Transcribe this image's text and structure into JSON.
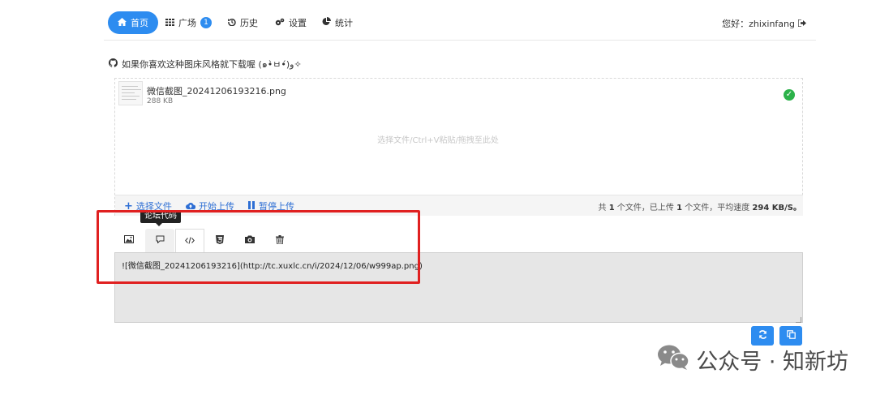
{
  "nav": {
    "items": [
      {
        "label": "首页",
        "icon": "home-icon"
      },
      {
        "label": "广场",
        "icon": "grid-icon",
        "badge": "1"
      },
      {
        "label": "历史",
        "icon": "history-icon"
      },
      {
        "label": "设置",
        "icon": "gear-icon"
      },
      {
        "label": "统计",
        "icon": "pie-chart-icon"
      }
    ],
    "greeting": "您好：zhixinfang",
    "accent": "#2d8cf0"
  },
  "notice": "如果你喜欢这种图床风格就下载喔 (๑•̀ㅂ•́)و✧",
  "upload": {
    "file_name": "微信截图_20241206193216.png",
    "file_size": "288 KB",
    "dropzone_hint": "选择文件/Ctrl+V粘贴/拖拽至此处",
    "select_label": "选择文件",
    "start_label": "开始上传",
    "pause_label": "暂停上传",
    "summary": {
      "prefix": "共",
      "total": "1",
      "mid": "个文件，已上传",
      "uploaded": "1",
      "suffix": "个文件，平均速度",
      "speed": "294 KB/S。"
    }
  },
  "toolbar": {
    "tooltip": "论坛代码",
    "items": [
      "image-icon",
      "comment-icon",
      "code-icon",
      "html5-icon",
      "camera-icon",
      "trash-icon"
    ]
  },
  "output": {
    "text": "![微信截图_20241206193216](http://tc.xuxlc.cn/i/2024/12/06/w999ap.png)"
  },
  "actions": [
    "refresh-icon",
    "copy-icon"
  ],
  "watermark": "公众号 · 知新坊"
}
